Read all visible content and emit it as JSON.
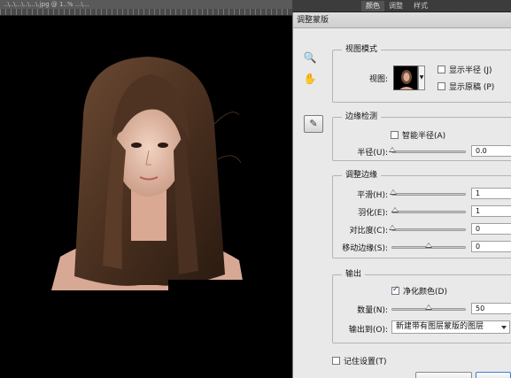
{
  "window": {
    "document_tab": "..\\..\\...\\..\\...\\.jpg @ 1..% ...\\..."
  },
  "panel_tabs": [
    "颜色",
    "调整",
    "样式"
  ],
  "dialog": {
    "title": "调整蒙版",
    "tools": {
      "zoom_icon": "magnifier-icon",
      "hand_icon": "hand-icon",
      "refine_radius_icon": "refine-radius-brush-icon"
    },
    "view_mode": {
      "legend": "视图模式",
      "view_label": "视图:",
      "show_radius": {
        "label": "显示半径 (J)",
        "checked": false
      },
      "show_original": {
        "label": "显示原稿 (P)",
        "checked": false
      }
    },
    "edge_detection": {
      "legend": "边缘检测",
      "smart_radius": {
        "label": "智能半径(A)",
        "checked": false
      },
      "radius": {
        "label": "半径(U):",
        "value": "0.0",
        "level": 0
      }
    },
    "adjust_edge": {
      "legend": "调整边缘",
      "smooth": {
        "label": "平滑(H):",
        "value": "1",
        "level": 0.01
      },
      "feather": {
        "label": "羽化(E):",
        "value": "1",
        "level": 0.04
      },
      "contrast": {
        "label": "对比度(C):",
        "value": "0",
        "level": 0
      },
      "shift_edge": {
        "label": "移动边缘(S):",
        "value": "0",
        "level": 0.5
      }
    },
    "output": {
      "legend": "输出",
      "decontaminate": {
        "label": "净化颜色(D)",
        "checked": true
      },
      "amount": {
        "label": "数量(N):",
        "value": "50",
        "level": 0.5
      },
      "output_to": {
        "label": "输出到(O):",
        "selected": "新建带有图层蒙版的图层"
      }
    },
    "remember": {
      "label": "记住设置(T)",
      "checked": false
    }
  },
  "colors": {
    "canvas_bg": "#000000",
    "dialog_bg": "#e9e9e9",
    "accent": "#3d7bd6"
  }
}
